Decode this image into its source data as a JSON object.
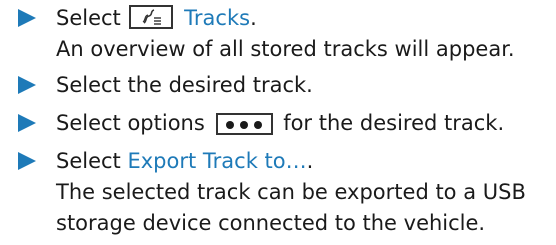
{
  "steps": [
    {
      "lines": [
        {
          "before": "Select",
          "link": "Tracks",
          "after": "."
        },
        {
          "text": "An overview of all stored tracks will appear."
        }
      ],
      "icon": "tracks-icon"
    },
    {
      "lines": [
        {
          "text": "Select the desired track."
        }
      ]
    },
    {
      "lines": [
        {
          "before": "Select options",
          "after": "for the desired track."
        }
      ],
      "icon": "options-icon"
    },
    {
      "lines": [
        {
          "before": "Select",
          "link": "Export Track to…",
          "after": "."
        },
        {
          "text": "The selected track can be exported to a USB"
        },
        {
          "text": "storage device connected to the vehicle."
        }
      ]
    }
  ],
  "colors": {
    "accent": "#1e7ab8",
    "text": "#1a1a1a"
  }
}
